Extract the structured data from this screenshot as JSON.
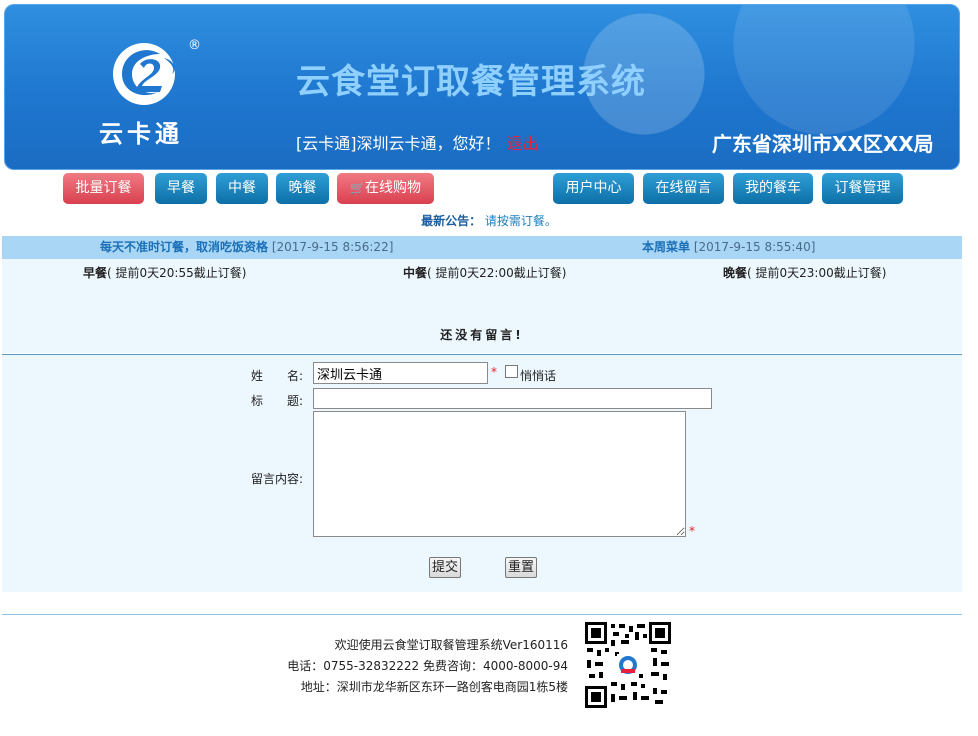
{
  "header": {
    "logo_text": "云卡通",
    "registered_mark": "®",
    "system_title": "云食堂订取餐管理系统",
    "welcome_text": "[云卡通]深圳云卡通，您好！",
    "logout_label": "退出",
    "organization": "广东省深圳市XX区XX局"
  },
  "nav": {
    "left": [
      "批量订餐",
      "早餐",
      "中餐",
      "晚餐",
      "在线购物"
    ],
    "right": [
      "用户中心",
      "在线留言",
      "我的餐车",
      "订餐管理"
    ]
  },
  "notice": {
    "label": "最新公告：",
    "text": "请按需订餐。"
  },
  "infobar": {
    "left_label": "每天不准时订餐，取消吃饭资格",
    "left_time": "[2017-9-15 8:56:22]",
    "right_label": "本周菜单",
    "right_time": "[2017-9-15 8:55:40]"
  },
  "meals": [
    {
      "name": "早餐",
      "rule": "( 提前0天20:55截止订餐)"
    },
    {
      "name": "中餐",
      "rule": "( 提前0天22:00截止订餐)"
    },
    {
      "name": "晚餐",
      "rule": "( 提前0天23:00截止订餐)"
    }
  ],
  "no_message_text": "还没有留言!",
  "form": {
    "name_label": "姓　　名:",
    "name_value": "深圳云卡通",
    "required_mark": "*",
    "whisper_label": "悄悄话",
    "title_label": "标　　题:",
    "title_value": "",
    "content_label": "留言内容:",
    "content_value": "",
    "submit_label": "提交",
    "reset_label": "重置"
  },
  "footer": {
    "line1": "欢迎使用云食堂订取餐管理系统Ver160116",
    "line2": "电话：0755-32832222 免费咨询：4000-8000-94",
    "line3": "地址：深圳市龙华新区东环一路创客电商园1栋5楼"
  },
  "colors": {
    "header_blue": "#1f77cf",
    "title_light_blue": "#8fd0ff",
    "nav_red": "#d9404f",
    "nav_blue": "#0d6fa7",
    "infobar_bg": "#a8d6f4",
    "panel_bg": "#ecf7fe",
    "required_red": "#e22222"
  }
}
